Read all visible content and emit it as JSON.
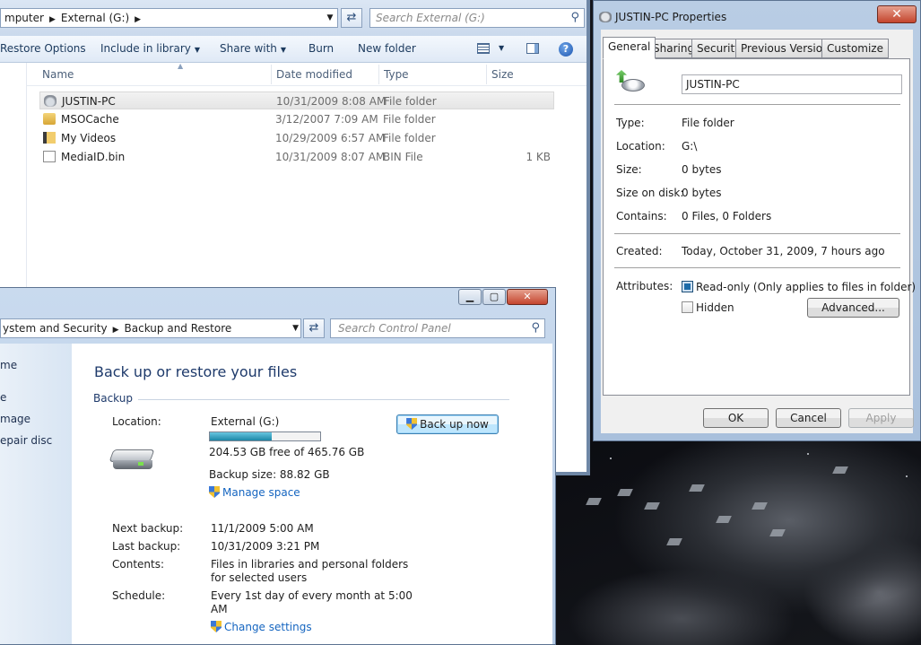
{
  "explorer": {
    "breadcrumb": [
      "mputer",
      "External (G:)"
    ],
    "search_placeholder": "Search External (G:)",
    "toolbar": {
      "restore_options": "Restore Options",
      "include_in_library": "Include in library",
      "share_with": "Share with",
      "burn": "Burn",
      "new_folder": "New folder"
    },
    "columns": {
      "name": "Name",
      "date_modified": "Date modified",
      "type": "Type",
      "size": "Size"
    },
    "files": [
      {
        "name": "JUSTIN-PC",
        "date": "10/31/2009 8:08 AM",
        "type": "File folder",
        "size": "",
        "icon": "drive-folder-icon"
      },
      {
        "name": "MSOCache",
        "date": "3/12/2007 7:09 AM",
        "type": "File folder",
        "size": "",
        "icon": "locked-folder-icon"
      },
      {
        "name": "My Videos",
        "date": "10/29/2009 6:57 AM",
        "type": "File folder",
        "size": "",
        "icon": "videos-folder-icon"
      },
      {
        "name": "MediaID.bin",
        "date": "10/31/2009 8:07 AM",
        "type": "BIN File",
        "size": "1 KB",
        "icon": "file-icon"
      }
    ]
  },
  "properties": {
    "title": "JUSTIN-PC Properties",
    "close_glyph": "✕",
    "tabs": [
      "General",
      "Sharing",
      "Security",
      "Previous Versions",
      "Customize"
    ],
    "name_value": "JUSTIN-PC",
    "rows": {
      "type_label": "Type:",
      "type_value": "File folder",
      "location_label": "Location:",
      "location_value": "G:\\",
      "size_label": "Size:",
      "size_value": "0 bytes",
      "size_on_disk_label": "Size on disk:",
      "size_on_disk_value": "0 bytes",
      "contains_label": "Contains:",
      "contains_value": "0 Files, 0 Folders",
      "created_label": "Created:",
      "created_value": "Today, October 31, 2009, 7 hours ago",
      "attributes_label": "Attributes:"
    },
    "readonly_label": "Read-only (Only applies to files in folder)",
    "hidden_label": "Hidden",
    "advanced_button": "Advanced...",
    "ok_button": "OK",
    "cancel_button": "Cancel",
    "apply_button": "Apply"
  },
  "backup": {
    "breadcrumb": [
      "ystem and Security",
      "Backup and Restore"
    ],
    "search_placeholder": "Search Control Panel",
    "left_links": [
      "me",
      "e",
      "mage",
      "epair disc"
    ],
    "title": "Back up or restore your files",
    "section": "Backup",
    "location_label": "Location:",
    "location_value": "External (G:)",
    "free_space": "204.53 GB free of 465.76 GB",
    "usage_fraction": 0.56,
    "backup_size": "Backup size: 88.82 GB",
    "manage_space": "Manage space",
    "back_up_now": "Back up now",
    "next_backup_label": "Next backup:",
    "next_backup_value": "11/1/2009 5:00 AM",
    "last_backup_label": "Last backup:",
    "last_backup_value": "10/31/2009 3:21 PM",
    "contents_label": "Contents:",
    "contents_line1": "Files in libraries and personal folders",
    "contents_line2": "for selected users",
    "schedule_label": "Schedule:",
    "schedule_line1": "Every 1st day of every month at 5:00",
    "schedule_line2": "AM",
    "change_settings": "Change settings"
  },
  "colors": {
    "accent": "#1565c0",
    "title": "#1e3a6b",
    "close": "#c4452e"
  }
}
